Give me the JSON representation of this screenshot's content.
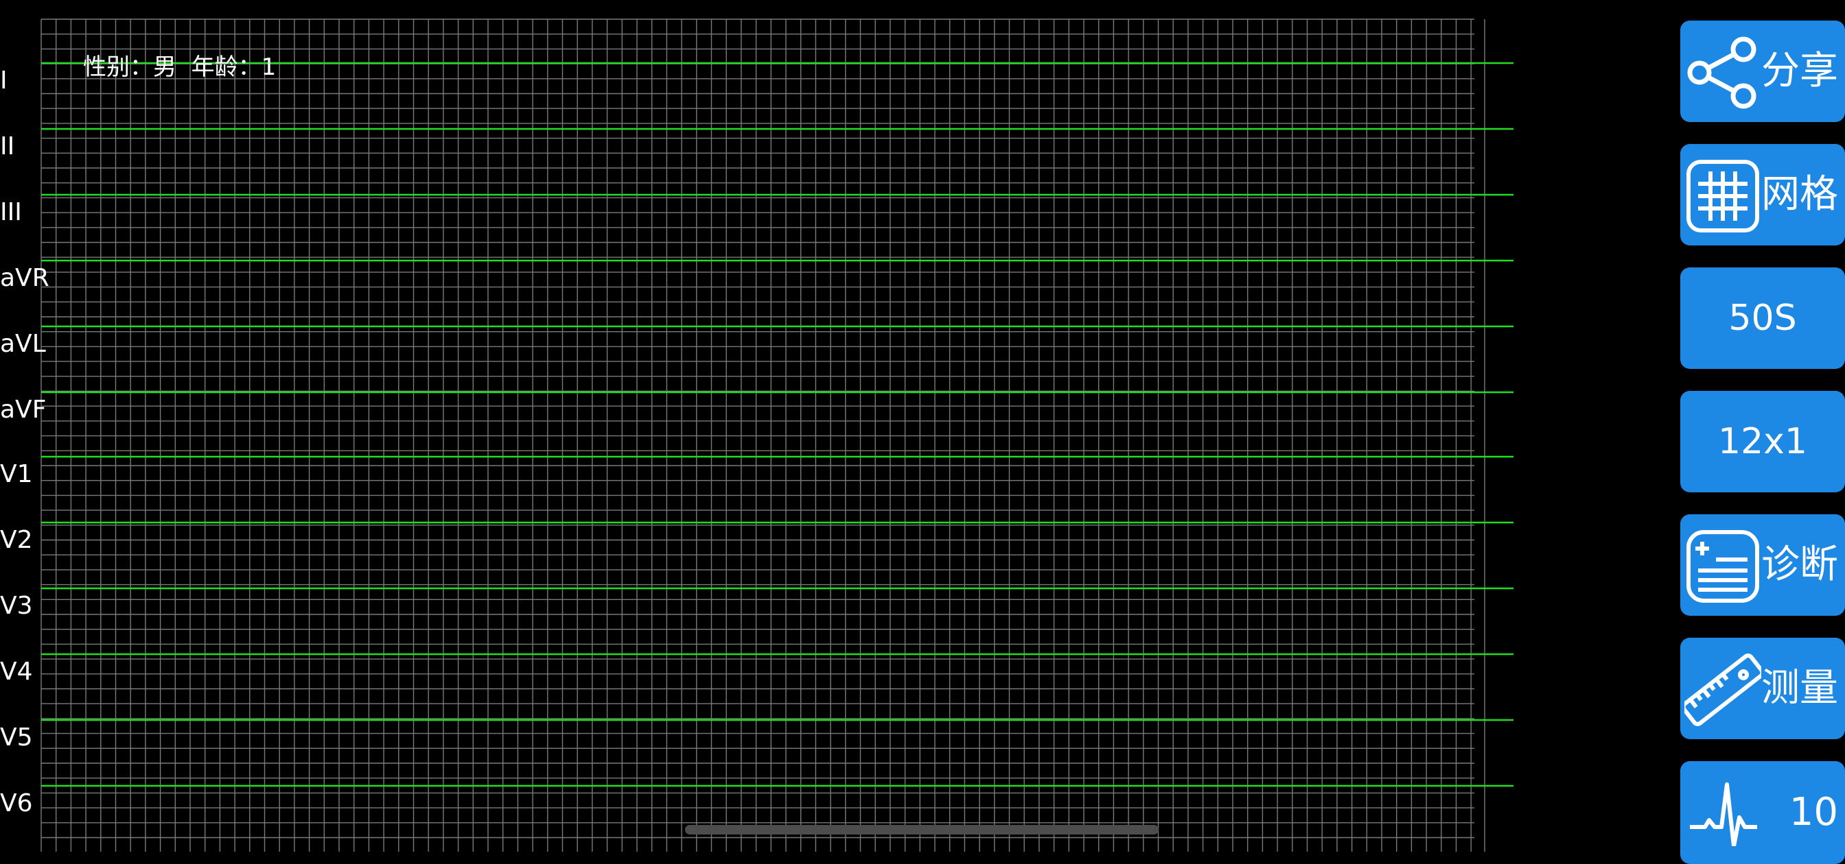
{
  "patient": {
    "gender_label": "性别：",
    "gender_value": "男",
    "age_label": "年龄：",
    "age_value": "1"
  },
  "leads": [
    "I",
    "II",
    "III",
    "aVR",
    "aVL",
    "aVF",
    "V1",
    "V2",
    "V3",
    "V4",
    "V5",
    "V6"
  ],
  "colors": {
    "background": "#000000",
    "grid": "#7a7a7a",
    "trace": "#22dd22",
    "button": "#1e88e5",
    "button_text": "#ffffff"
  },
  "sidebar": {
    "share": {
      "label": "分享",
      "icon": "share-icon"
    },
    "grid": {
      "label": "网格",
      "icon": "grid-icon"
    },
    "speed": {
      "label": "50S"
    },
    "layout": {
      "label": "12x1"
    },
    "diagnosis": {
      "label": "诊断",
      "icon": "medical-record-icon"
    },
    "measure": {
      "label": "测量",
      "icon": "ruler-icon"
    },
    "gain": {
      "label": "10",
      "icon": "ecg-wave-icon"
    }
  }
}
